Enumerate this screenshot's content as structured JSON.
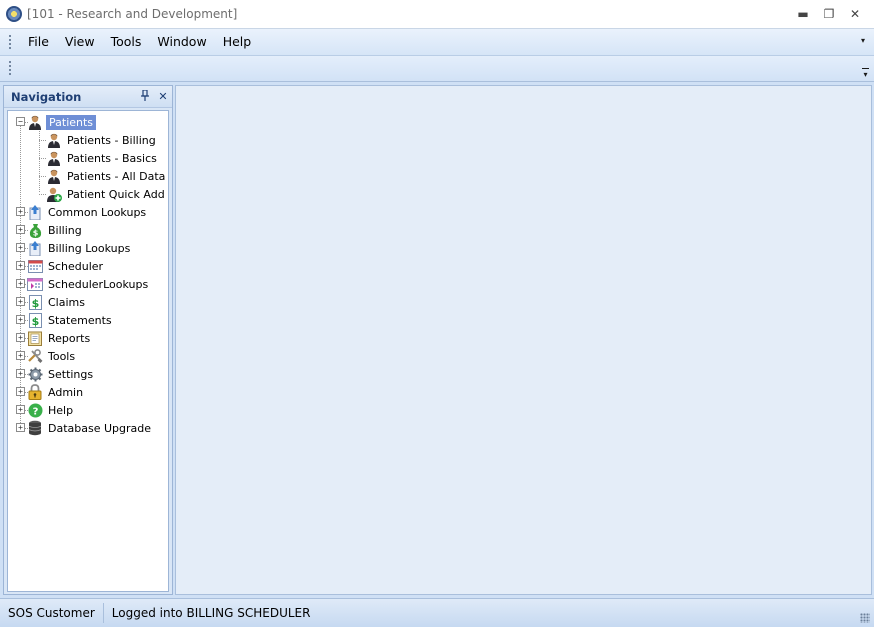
{
  "window": {
    "title": "[101 - Research and Development]",
    "minimize": "▬",
    "restore": "❐",
    "close": "✕"
  },
  "menu": {
    "items": [
      "File",
      "View",
      "Tools",
      "Window",
      "Help"
    ],
    "overflow": "▾"
  },
  "toolbar": {
    "overflow": "▾"
  },
  "navigation": {
    "title": "Navigation",
    "pin": "⊥",
    "close": "✕",
    "tree": [
      {
        "label": "Patients",
        "icon": "patient-icon",
        "expanded": true,
        "selected": true,
        "children": [
          {
            "label": "Patients - Billing",
            "icon": "patient-icon"
          },
          {
            "label": "Patients - Basics",
            "icon": "patient-icon"
          },
          {
            "label": "Patients - All Data",
            "icon": "patient-icon"
          },
          {
            "label": "Patient Quick Add",
            "icon": "patient-add-icon"
          }
        ]
      },
      {
        "label": "Common Lookups",
        "icon": "lookup-icon"
      },
      {
        "label": "Billing",
        "icon": "money-bag-icon"
      },
      {
        "label": "Billing Lookups",
        "icon": "lookup-icon"
      },
      {
        "label": "Scheduler",
        "icon": "calendar-icon"
      },
      {
        "label": "SchedulerLookups",
        "icon": "calendar-lookup-icon"
      },
      {
        "label": "Claims",
        "icon": "dollar-doc-icon"
      },
      {
        "label": "Statements",
        "icon": "dollar-doc-icon"
      },
      {
        "label": "Reports",
        "icon": "report-icon"
      },
      {
        "label": "Tools",
        "icon": "tools-icon"
      },
      {
        "label": "Settings",
        "icon": "gear-icon"
      },
      {
        "label": "Admin",
        "icon": "lock-icon"
      },
      {
        "label": "Help",
        "icon": "help-icon"
      },
      {
        "label": "Database Upgrade",
        "icon": "database-icon"
      }
    ]
  },
  "status": {
    "customer": "SOS Customer",
    "login": "Logged into BILLING  SCHEDULER"
  }
}
